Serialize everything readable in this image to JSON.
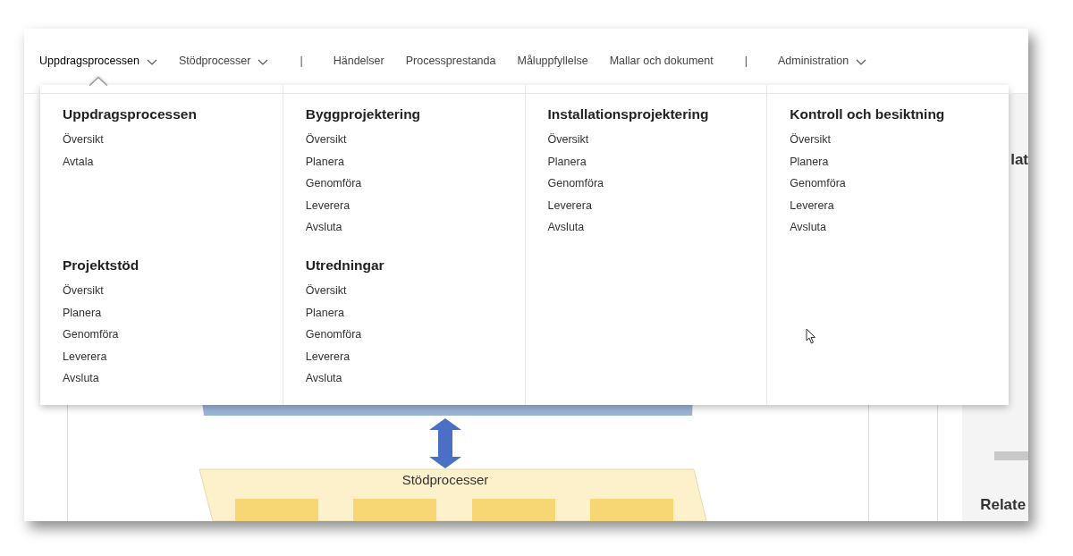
{
  "nav": [
    {
      "kind": "menu",
      "label": "Uppdragsprocessen",
      "selected": true
    },
    {
      "kind": "menu",
      "label": "Stödprocesser",
      "selected": false
    },
    {
      "kind": "separator",
      "label": "|"
    },
    {
      "kind": "link",
      "label": "Händelser",
      "selected": false
    },
    {
      "kind": "link",
      "label": "Processprestanda",
      "selected": false
    },
    {
      "kind": "link",
      "label": "Måluppfyllelse",
      "selected": false
    },
    {
      "kind": "link",
      "label": "Mallar och dokument",
      "selected": false
    },
    {
      "kind": "separator",
      "label": "|"
    },
    {
      "kind": "menu",
      "label": "Administration",
      "selected": false
    }
  ],
  "dropdown": {
    "columns": [
      {
        "sections": [
          {
            "title": "Uppdragsprocessen",
            "links": [
              "Översikt",
              "Avtala"
            ]
          },
          {
            "title": "Projektstöd",
            "links": [
              "Översikt",
              "Planera",
              "Genomföra",
              "Leverera",
              "Avsluta"
            ]
          }
        ]
      },
      {
        "sections": [
          {
            "title": "Byggprojektering",
            "links": [
              "Översikt",
              "Planera",
              "Genomföra",
              "Leverera",
              "Avsluta"
            ]
          },
          {
            "title": "Utredningar",
            "links": [
              "Översikt",
              "Planera",
              "Genomföra",
              "Leverera",
              "Avsluta"
            ]
          }
        ]
      },
      {
        "sections": [
          {
            "title": "Installationsprojektering",
            "links": [
              "Översikt",
              "Planera",
              "Genomföra",
              "Leverera",
              "Avsluta"
            ]
          }
        ]
      },
      {
        "sections": [
          {
            "title": "Kontroll och besiktning",
            "links": [
              "Översikt",
              "Planera",
              "Genomföra",
              "Leverera",
              "Avsluta"
            ]
          }
        ]
      }
    ]
  },
  "diagram": {
    "support_title": "Stödprocesser"
  },
  "side_panel": {
    "headings": [
      "lat",
      "Relate"
    ]
  }
}
